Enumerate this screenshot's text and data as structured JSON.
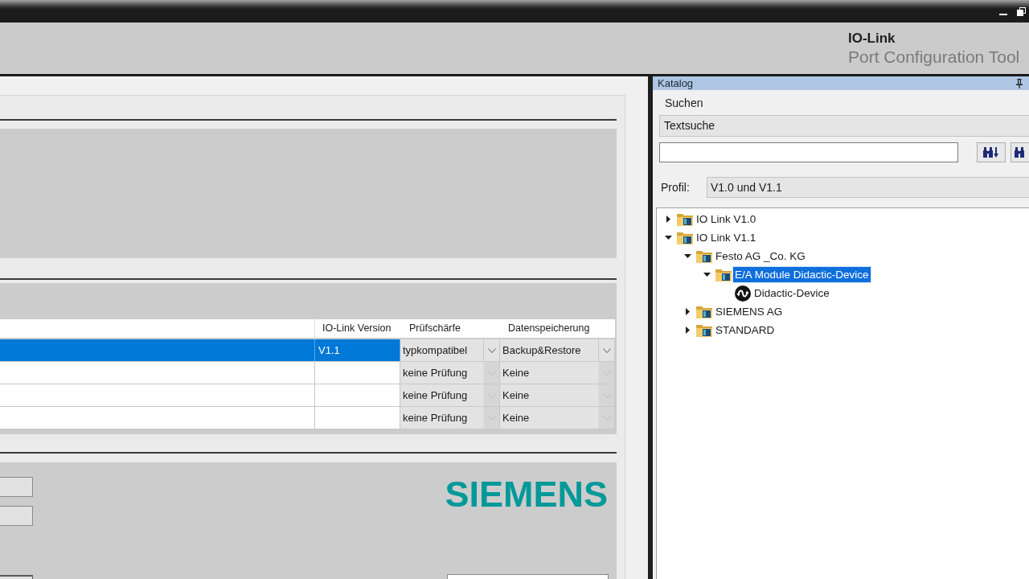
{
  "header": {
    "title": "IO-Link",
    "subtitle": "Port Configuration Tool"
  },
  "device_table": {
    "columns": [
      "IO-Link Version",
      "Prüfschärfe",
      "Datenspeicherung"
    ],
    "rows": [
      {
        "selected": true,
        "io_link_version": "V1.1",
        "pruefschaerfe": {
          "value": "typkompatibel",
          "disabled": false
        },
        "datenspeicherung": {
          "value": "Backup&Restore",
          "disabled": false
        }
      },
      {
        "selected": false,
        "pruefschaerfe": {
          "value": "keine Prüfung",
          "disabled": true
        },
        "datenspeicherung": {
          "value": "Keine",
          "disabled": true
        }
      },
      {
        "selected": false,
        "pruefschaerfe": {
          "value": "keine Prüfung",
          "disabled": true
        },
        "datenspeicherung": {
          "value": "Keine",
          "disabled": true
        }
      },
      {
        "selected": false,
        "pruefschaerfe": {
          "value": "keine Prüfung",
          "disabled": true
        },
        "datenspeicherung": {
          "value": "Keine",
          "disabled": true
        }
      }
    ]
  },
  "logo": {
    "text": "SIEMENS"
  },
  "catalog": {
    "title": "Katalog",
    "search_group": "Suchen",
    "search_mode": "Textsuche",
    "profile": {
      "label": "Profil:",
      "value": "V1.0 und V1.1"
    },
    "tree": [
      {
        "label": "IO Link V1.0",
        "kind": "folder",
        "expanded": false,
        "selected": false
      },
      {
        "label": "IO Link V1.1",
        "kind": "folder",
        "expanded": true,
        "selected": false,
        "children": [
          {
            "label": "Festo AG _Co. KG",
            "kind": "folder",
            "expanded": true,
            "selected": false,
            "children": [
              {
                "label": "E/A Module Didactic-Device",
                "kind": "folder",
                "expanded": true,
                "selected": true,
                "children": [
                  {
                    "label": "Didactic-Device",
                    "kind": "device",
                    "selected": false
                  }
                ]
              }
            ]
          },
          {
            "label": "SIEMENS AG",
            "kind": "folder",
            "expanded": false,
            "selected": false
          },
          {
            "label": "STANDARD",
            "kind": "folder",
            "expanded": false,
            "selected": false
          }
        ]
      }
    ]
  }
}
